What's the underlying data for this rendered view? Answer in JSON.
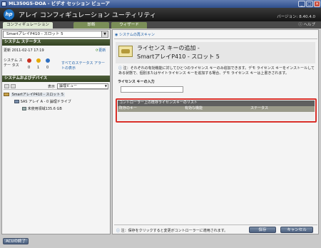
{
  "window": {
    "title": "ML350G5-DOA - ビデオ セッション ビューア",
    "minimize": "_",
    "maximize": "□",
    "close": "×"
  },
  "header": {
    "logo": "hp",
    "app_title": "アレイ コンフィギュレーション ユーティリティ",
    "version": "バージョン: 8.40.4.0"
  },
  "tabs": [
    {
      "label": "コンフィギュレーション"
    },
    {
      "label": "診断"
    },
    {
      "label": "ウィザード"
    }
  ],
  "help": "ヘルプ",
  "left": {
    "controller_select": "SmartアレイP410 - スロット 5",
    "status_section": {
      "title": "システム ステータス",
      "updated": "更新 2011-02-17 17:19",
      "refresh": "更新",
      "status_label": "システム ステー タス",
      "counts": [
        "0",
        "1",
        "0"
      ],
      "all_alerts_link": "すべてのステータス アラートの表示"
    },
    "devices_section": {
      "title": "システムおよびデバイス",
      "view_label": "表示",
      "view_value": "論理ビュー",
      "tree": [
        "SmartアレイP410 - スロット 5",
        "SAS アレイ A - 0 論理ドライブ",
        "未使用領域135.6 GB"
      ]
    }
  },
  "right": {
    "rescan_link": "システムの再スキャン",
    "heading_line1": "ライセンス キーの追加 -",
    "heading_line2": "SmartアレイP410 - スロット 5",
    "note": "注：それぞれの有効機能に対してひとつのライセンス キーのみ追加できます。デモ ライセンス キーをインストールしてある状態で、個別またはサイトライセンス キーを追加する場合、デモ ライセンス キーは上書きされます。",
    "license_key_label": "ライセンス キーの入力",
    "license_key_value": "",
    "table": {
      "title": "コントローラー上の既存ライセンスキーのリスト",
      "columns": [
        "既存のキー",
        "有効な機能",
        "ステータス"
      ]
    },
    "footer_note": "注：保存をクリックすると変更がコントローラーに適用されます。",
    "save": "保存",
    "cancel": "キャンセル"
  },
  "bottom": {
    "exit": "ACUの終了"
  }
}
